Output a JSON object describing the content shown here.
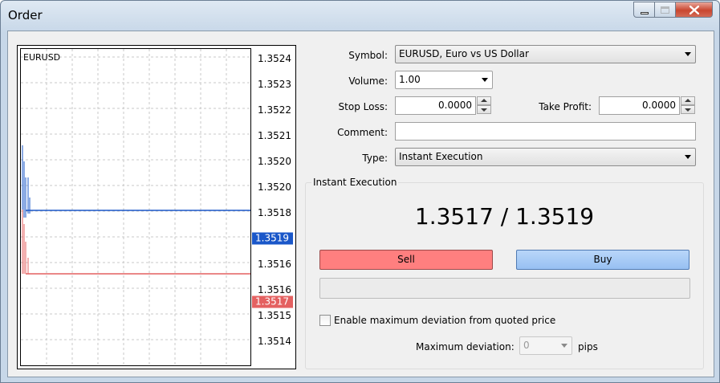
{
  "window": {
    "title": "Order"
  },
  "chart": {
    "symbol": "EURUSD",
    "y_ticks": [
      "1.3524",
      "1.3523",
      "1.3522",
      "1.3521",
      "1.3520",
      "1.3520",
      "1.3518",
      "1.3517",
      "1.3516",
      "1.3516",
      "1.3515",
      "1.3514"
    ],
    "ask_tag": "1.3519",
    "bid_tag": "1.3517",
    "ask_color": "#1a57c9",
    "bid_color": "#e46161"
  },
  "form": {
    "symbol_label": "Symbol:",
    "symbol_value": "EURUSD, Euro vs US Dollar",
    "volume_label": "Volume:",
    "volume_value": "1.00",
    "stoploss_label": "Stop Loss:",
    "stoploss_value": "0.0000",
    "takeprofit_label": "Take Profit:",
    "takeprofit_value": "0.0000",
    "comment_label": "Comment:",
    "comment_value": "",
    "type_label": "Type:",
    "type_value": "Instant Execution"
  },
  "execution": {
    "group_title": "Instant Execution",
    "quote": "1.3517 / 1.3519",
    "sell_label": "Sell",
    "buy_label": "Buy",
    "deviation_checkbox_label": "Enable maximum deviation from quoted price",
    "deviation_checked": false,
    "max_deviation_label": "Maximum deviation:",
    "max_deviation_value": "0",
    "pips_label": "pips"
  }
}
